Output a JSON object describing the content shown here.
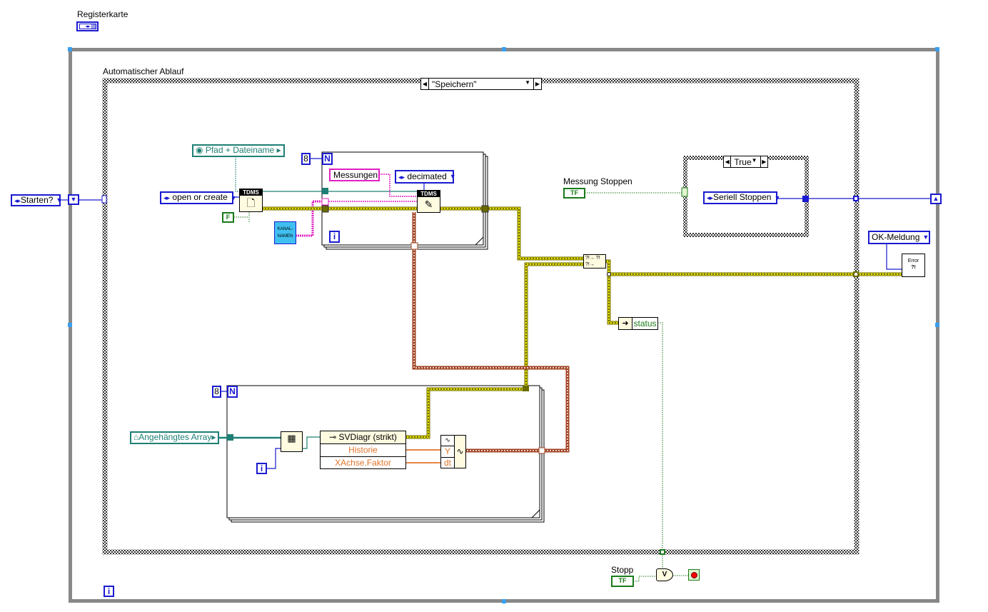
{
  "tab_control": {
    "label": "Registerkarte"
  },
  "while_loop": {
    "iteration_label": "i"
  },
  "case_structure": {
    "label": "Automatischer Ablauf",
    "selector_value": "\"Speichern\""
  },
  "shift_register": {
    "input_label": "Starten?"
  },
  "file_path": {
    "label": "Pfad + Dateiname"
  },
  "tdms_open": {
    "operation": "open or create",
    "title": "TDMS",
    "bool_constant": "F"
  },
  "channel_names": {
    "label": "KANAL-\nNAMEN"
  },
  "for_loop_1": {
    "count": "8",
    "count_terminal": "N",
    "iteration": "i"
  },
  "tdms_write": {
    "title": "TDMS",
    "group_name": "Messungen",
    "mode": "decimated"
  },
  "merge_errors": {
    "icon": "merge-errors-icon"
  },
  "unbundle": {
    "field": "status"
  },
  "measure_stop": {
    "label": "Messung Stoppen",
    "value": "TF"
  },
  "inner_case": {
    "selector_value": "True",
    "enum_value": "Seriell Stoppen"
  },
  "error_dialog": {
    "type": "OK-Meldung",
    "icon_text": "Error"
  },
  "for_loop_2": {
    "count": "8",
    "count_terminal": "N",
    "iteration": "i"
  },
  "array_input": {
    "label": "Angehängtes Array"
  },
  "property_node": {
    "name": "SVDiagr (strikt)",
    "props": [
      "Historie",
      "XAchse.Faktor"
    ]
  },
  "build_waveform": {
    "inputs": [
      "Y",
      "dt"
    ]
  },
  "stop": {
    "label": "Stopp",
    "value": "TF",
    "or_symbol": "V"
  },
  "colors": {
    "error_wire": "#e8e000",
    "enum_blue": "#1a1ad0",
    "path_teal": "#1e7f74",
    "string_pink": "#e020c0",
    "bool_green": "#1a7a1a",
    "waveform_brown": "#a04020",
    "float_orange": "#e0742a",
    "loop_gray": "#808080"
  }
}
